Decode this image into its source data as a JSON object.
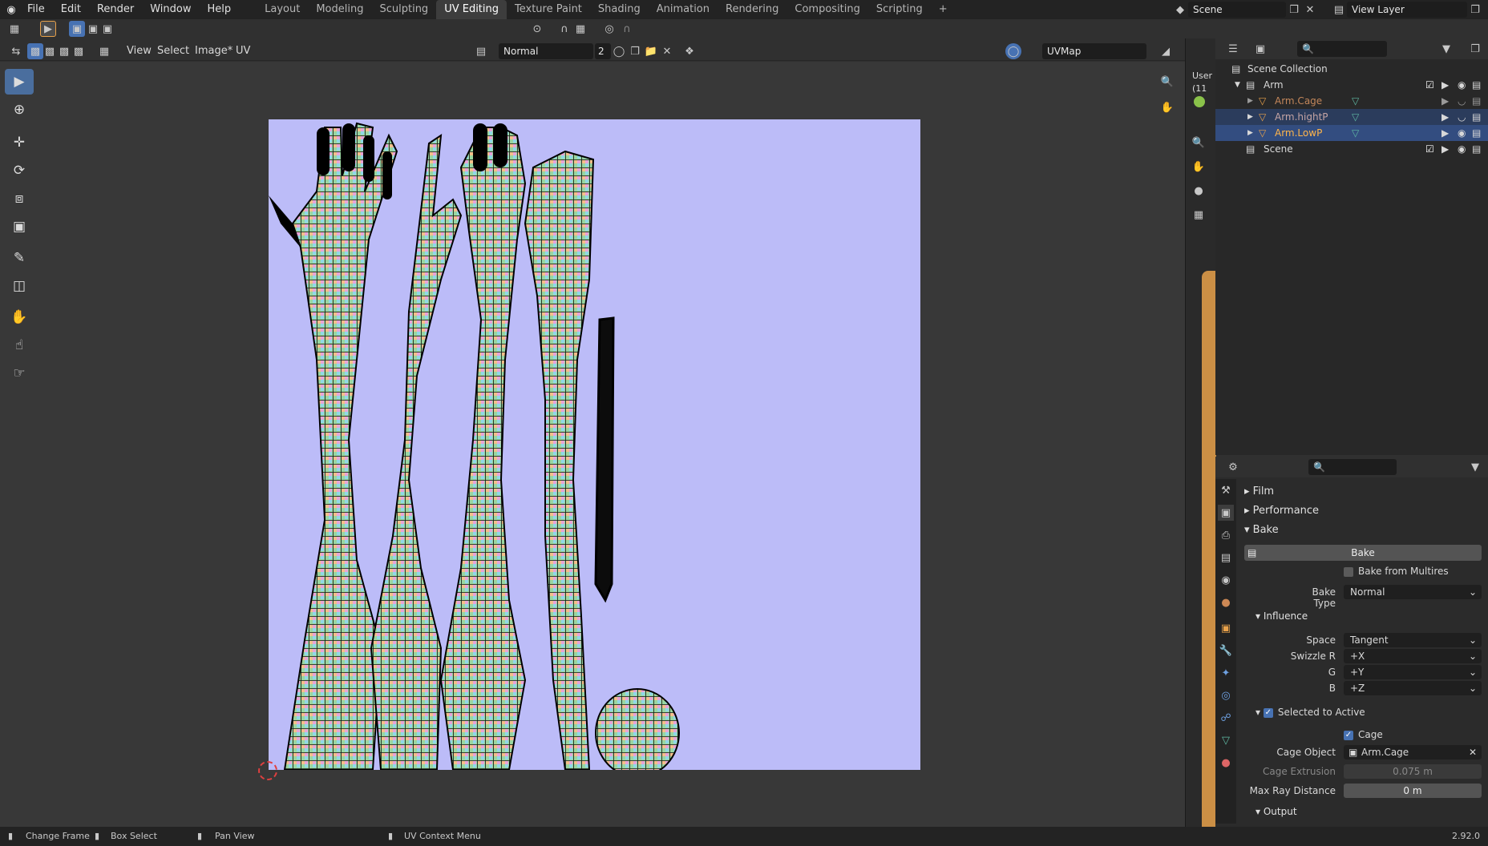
{
  "topbar": {
    "menus": [
      "File",
      "Edit",
      "Render",
      "Window",
      "Help"
    ],
    "workspaces": [
      "Layout",
      "Modeling",
      "Sculpting",
      "UV Editing",
      "Texture Paint",
      "Shading",
      "Animation",
      "Rendering",
      "Compositing",
      "Scripting"
    ],
    "active_workspace": "UV Editing",
    "add_tab": "+",
    "scene": "Scene",
    "view_layer": "View Layer"
  },
  "uv_header": {
    "menus": [
      "View",
      "Select",
      "Image*",
      "UV"
    ],
    "image_name": "Normal",
    "user_count": "2",
    "uvmap": "UVMap"
  },
  "viewport_overlay": {
    "text1": "User",
    "text2": "(11"
  },
  "outliner": {
    "root": "Scene Collection",
    "collection": "Arm",
    "objects": [
      "Arm.Cage",
      "Arm.hightP",
      "Arm.LowP"
    ],
    "scene_item": "Scene"
  },
  "properties": {
    "panels": {
      "film": "Film",
      "performance": "Performance",
      "bake": "Bake"
    },
    "bake_button": "Bake",
    "bake_from_multires": "Bake from Multires",
    "bake_type_label": "Bake Type",
    "bake_type": "Normal",
    "influence": "Influence",
    "space_label": "Space",
    "space": "Tangent",
    "swizzle_r_label": "Swizzle R",
    "swizzle_r": "+X",
    "g_label": "G",
    "g": "+Y",
    "b_label": "B",
    "b": "+Z",
    "selected_to_active": "Selected to Active",
    "cage": "Cage",
    "cage_object_label": "Cage Object",
    "cage_object": "Arm.Cage",
    "cage_extrusion_label": "Cage Extrusion",
    "cage_extrusion": "0.075 m",
    "max_ray_label": "Max Ray Distance",
    "max_ray": "0 m",
    "output": "Output"
  },
  "status": {
    "change_frame": "Change Frame",
    "box_select": "Box Select",
    "pan_view": "Pan View",
    "context_menu": "UV Context Menu",
    "version": "2.92.0"
  },
  "colors": {
    "accent": "#4772b3",
    "canvas_bg": "#bcbcf8",
    "selected_row": "#334d80",
    "orange": "#e8a14a"
  }
}
